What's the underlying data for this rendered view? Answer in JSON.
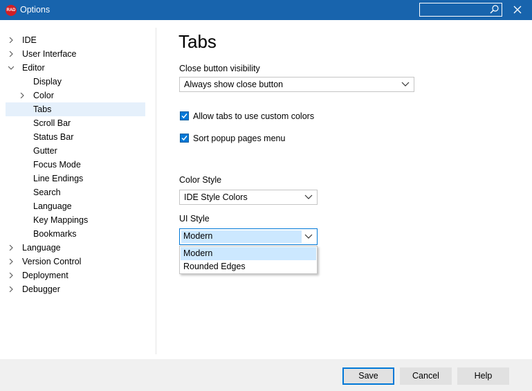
{
  "window": {
    "title": "Options",
    "app_icon_text": "RAD",
    "search_placeholder": ""
  },
  "tree": {
    "items": [
      {
        "label": "IDE",
        "expander": "collapsed"
      },
      {
        "label": "User Interface",
        "expander": "collapsed"
      },
      {
        "label": "Editor",
        "expander": "expanded"
      },
      {
        "label": "Display",
        "expander": "none"
      },
      {
        "label": "Color",
        "expander": "collapsed"
      },
      {
        "label": "Tabs",
        "expander": "none",
        "selected": true
      },
      {
        "label": "Scroll Bar",
        "expander": "none"
      },
      {
        "label": "Status Bar",
        "expander": "none"
      },
      {
        "label": "Gutter",
        "expander": "none"
      },
      {
        "label": "Focus Mode",
        "expander": "none"
      },
      {
        "label": "Line Endings",
        "expander": "none"
      },
      {
        "label": "Search",
        "expander": "none"
      },
      {
        "label": "Language",
        "expander": "none"
      },
      {
        "label": "Key Mappings",
        "expander": "none"
      },
      {
        "label": "Bookmarks",
        "expander": "none"
      },
      {
        "label": "Language",
        "expander": "collapsed"
      },
      {
        "label": "Version Control",
        "expander": "collapsed"
      },
      {
        "label": "Deployment",
        "expander": "collapsed"
      },
      {
        "label": "Debugger",
        "expander": "collapsed"
      }
    ]
  },
  "page": {
    "title": "Tabs",
    "close_button_visibility": {
      "label": "Close button visibility",
      "value": "Always show close button"
    },
    "allow_custom_colors": {
      "label": "Allow tabs to use custom colors",
      "checked": true
    },
    "sort_popup_pages": {
      "label": "Sort popup pages menu",
      "checked": true
    },
    "color_style": {
      "label": "Color Style",
      "value": "IDE Style Colors"
    },
    "ui_style": {
      "label": "UI Style",
      "value": "Modern",
      "options": [
        "Modern",
        "Rounded Edges"
      ],
      "highlighted": "Modern"
    }
  },
  "footer": {
    "save": "Save",
    "cancel": "Cancel",
    "help": "Help"
  },
  "colors": {
    "titlebar": "#1864ad",
    "accent": "#0078d7",
    "selection": "#e5f0fb",
    "highlight": "#cce8ff",
    "footer": "#f0f0f0"
  }
}
